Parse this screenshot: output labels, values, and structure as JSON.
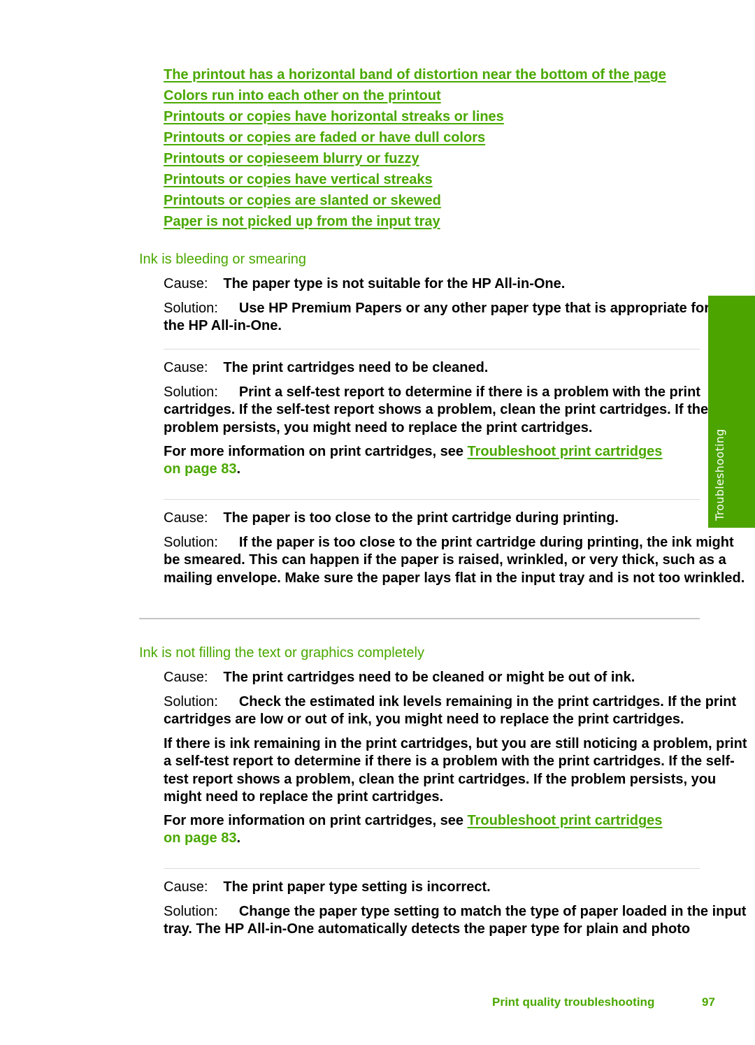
{
  "related_links": [
    "The printout has a horizontal band of distortion near the bottom of the page",
    "Colors run into each other on the printout",
    "Printouts or copies have horizontal streaks or lines",
    "Printouts or copies are faded or have dull colors",
    "Printouts or copieseem blurry or fuzzy",
    "Printouts or copies have vertical streaks",
    "Printouts or copies are slanted or skewed",
    "Paper is not picked up from the input tray"
  ],
  "labels": {
    "cause": "Cause:",
    "solution": "Solution:"
  },
  "sections": [
    {
      "heading": "Ink is bleeding or smearing",
      "entries": [
        {
          "cause": "The paper type is not suitable for the HP All-in-One.",
          "solution": "Use HP Premium Papers or any other paper type that is appropriate for the HP All-in-One."
        },
        {
          "cause": "The print cartridges need to be cleaned.",
          "solution": "Print a self-test report to determine if there is a problem with the print cartridges. If the self-test report shows a problem, clean the print cartridges. If the problem persists, you might need to replace the print cartridges.",
          "more_info_prefix": "For more information on print cartridges, see ",
          "more_info_link": "Troubleshoot print cartridges",
          "more_info_page": "on page 83",
          "more_info_suffix": "."
        },
        {
          "cause": "The paper is too close to the print cartridge during printing.",
          "solution": "If the paper is too close to the print cartridge during printing, the ink might be smeared. This can happen if the paper is raised, wrinkled, or very thick, such as a mailing envelope. Make sure the paper lays flat in the input tray and is not too wrinkled."
        }
      ]
    },
    {
      "heading": "Ink is not filling the text or graphics completely",
      "entries": [
        {
          "cause": "The print cartridges need to be cleaned or might be out of ink.",
          "solution": "Check the estimated ink levels remaining in the print cartridges. If the print cartridges are low or out of ink, you might need to replace the print cartridges.",
          "extra": "If there is ink remaining in the print cartridges, but you are still noticing a problem, print a self-test report to determine if there is a problem with the print cartridges. If the self-test report shows a problem, clean the print cartridges. If the problem persists, you might need to replace the print cartridges.",
          "more_info_prefix": "For more information on print cartridges, see ",
          "more_info_link": "Troubleshoot print cartridges",
          "more_info_page": "on page 83",
          "more_info_suffix": "."
        },
        {
          "cause": "The print paper type setting is incorrect.",
          "solution": "Change the paper type setting to match the type of paper loaded in the input tray. The HP All-in-One automatically detects the paper type for plain and photo"
        }
      ]
    }
  ],
  "side_tab": {
    "label": "Troubleshooting",
    "color": "#4ba400"
  },
  "footer": {
    "section_title": "Print quality troubleshooting",
    "page_number": "97"
  },
  "colors": {
    "accent_green": "#4aa800",
    "text": "#000000",
    "rule": "#c4c4c4"
  }
}
